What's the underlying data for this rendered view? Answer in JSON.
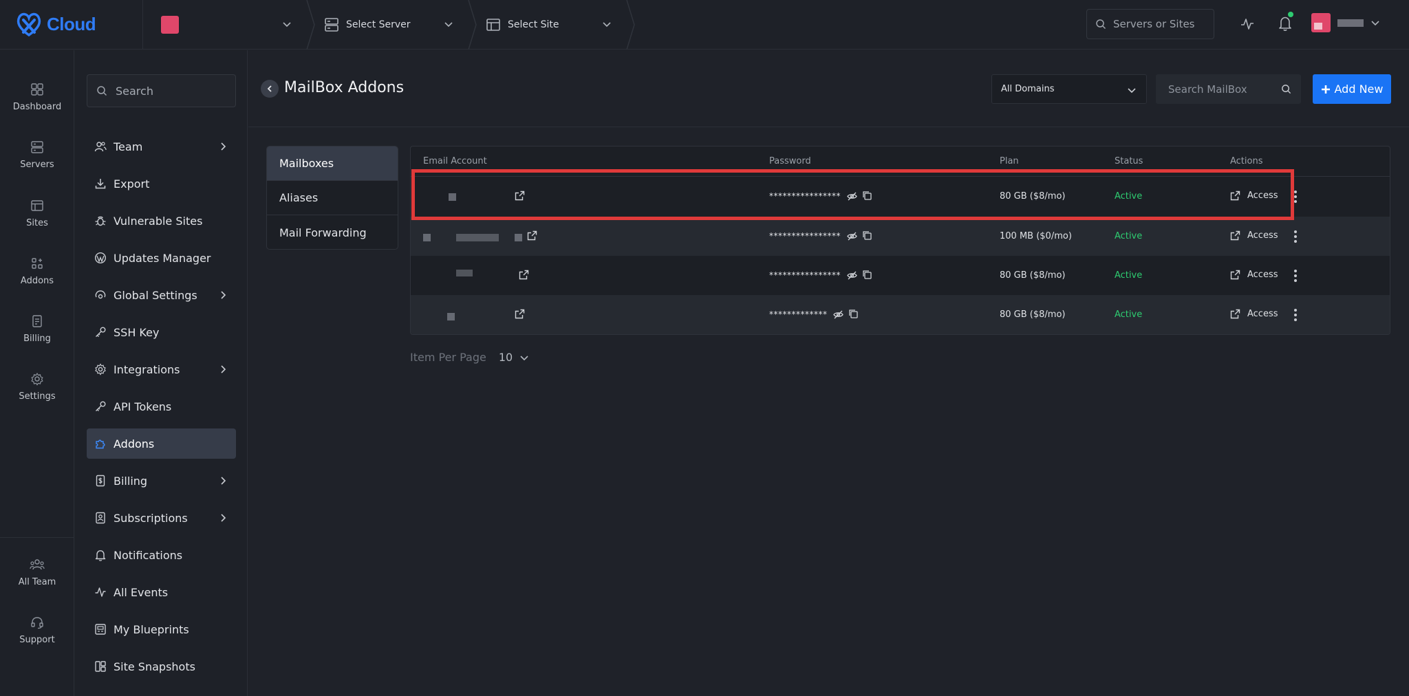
{
  "brand": {
    "name": "Cloud",
    "color": "#2f7cf6"
  },
  "topbar": {
    "server_label": "Select Server",
    "site_label": "Select Site",
    "search_placeholder": "Servers or Sites"
  },
  "rail": {
    "items": [
      {
        "label": "Dashboard",
        "icon": "dashboard-icon"
      },
      {
        "label": "Servers",
        "icon": "server-icon"
      },
      {
        "label": "Sites",
        "icon": "site-icon"
      },
      {
        "label": "Addons",
        "icon": "addons-icon"
      },
      {
        "label": "Billing",
        "icon": "billing-icon"
      },
      {
        "label": "Settings",
        "icon": "settings-icon"
      },
      {
        "label": "All Team",
        "icon": "team-icon"
      },
      {
        "label": "Support",
        "icon": "headset-icon"
      }
    ]
  },
  "sidebar": {
    "search_placeholder": "Search",
    "items": [
      {
        "label": "Team",
        "icon": "users-icon",
        "has_arrow": true
      },
      {
        "label": "Export",
        "icon": "download-icon",
        "has_arrow": false
      },
      {
        "label": "Vulnerable Sites",
        "icon": "bug-icon",
        "has_arrow": false
      },
      {
        "label": "Updates Manager",
        "icon": "wordpress-icon",
        "has_arrow": false
      },
      {
        "label": "Global Settings",
        "icon": "globe-settings-icon",
        "has_arrow": true
      },
      {
        "label": "SSH Key",
        "icon": "key-icon",
        "has_arrow": false
      },
      {
        "label": "Integrations",
        "icon": "gear-icon",
        "has_arrow": true
      },
      {
        "label": "API Tokens",
        "icon": "key-icon",
        "has_arrow": false
      },
      {
        "label": "Addons",
        "icon": "puzzle-icon",
        "has_arrow": false,
        "active": true
      },
      {
        "label": "Billing",
        "icon": "receipt-icon",
        "has_arrow": true
      },
      {
        "label": "Subscriptions",
        "icon": "subscription-icon",
        "has_arrow": true
      },
      {
        "label": "Notifications",
        "icon": "bell-icon",
        "has_arrow": false
      },
      {
        "label": "All Events",
        "icon": "activity-icon",
        "has_arrow": false
      },
      {
        "label": "My Blueprints",
        "icon": "blueprint-icon",
        "has_arrow": false
      },
      {
        "label": "Site Snapshots",
        "icon": "snapshot-icon",
        "has_arrow": false
      }
    ]
  },
  "page": {
    "title": "MailBox Addons",
    "domain_filter": "All Domains",
    "search_placeholder": "Search MailBox",
    "add_new_label": "Add New"
  },
  "tabs": [
    "Mailboxes",
    "Aliases",
    "Mail Forwarding"
  ],
  "table": {
    "columns": [
      "Email Account",
      "Password",
      "Plan",
      "Status",
      "Actions"
    ],
    "rows": [
      {
        "password": "****************",
        "plan": "80 GB ($8/mo)",
        "status": "Active",
        "action": "Access"
      },
      {
        "password": "****************",
        "plan": "100 MB ($0/mo)",
        "status": "Active",
        "action": "Access"
      },
      {
        "password": "****************",
        "plan": "80 GB ($8/mo)",
        "status": "Active",
        "action": "Access"
      },
      {
        "password": "*************",
        "plan": "80 GB ($8/mo)",
        "status": "Active",
        "action": "Access"
      }
    ]
  },
  "pagination": {
    "label": "Item Per Page",
    "value": "10"
  },
  "colors": {
    "accent": "#1a74f5",
    "active_status": "#2ecc71",
    "highlight": "#e03a3a"
  }
}
